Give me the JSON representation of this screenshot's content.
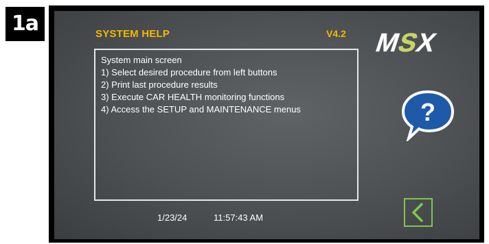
{
  "figure_label": "1a",
  "screen": {
    "title": "SYSTEM HELP",
    "version": "V4.2",
    "logo_text": "MSX",
    "help_lines": [
      "System main screen",
      "1) Select desired procedure from left buttons",
      "2) Print last procedure results",
      "3) Execute CAR HEALTH monitoring functions",
      "4) Access the SETUP and MAINTENANCE menus"
    ],
    "help_icon_glyph": "?",
    "date": "1/23/24",
    "time": "11:57:43 AM",
    "back_icon": "chevron-left-icon"
  },
  "colors": {
    "title": "#f2b800",
    "logo_accent": "#c8d84a",
    "help_bubble": "#1f5aa8",
    "back_button": "#7ec84a",
    "screen_bg": "#4d5053"
  }
}
